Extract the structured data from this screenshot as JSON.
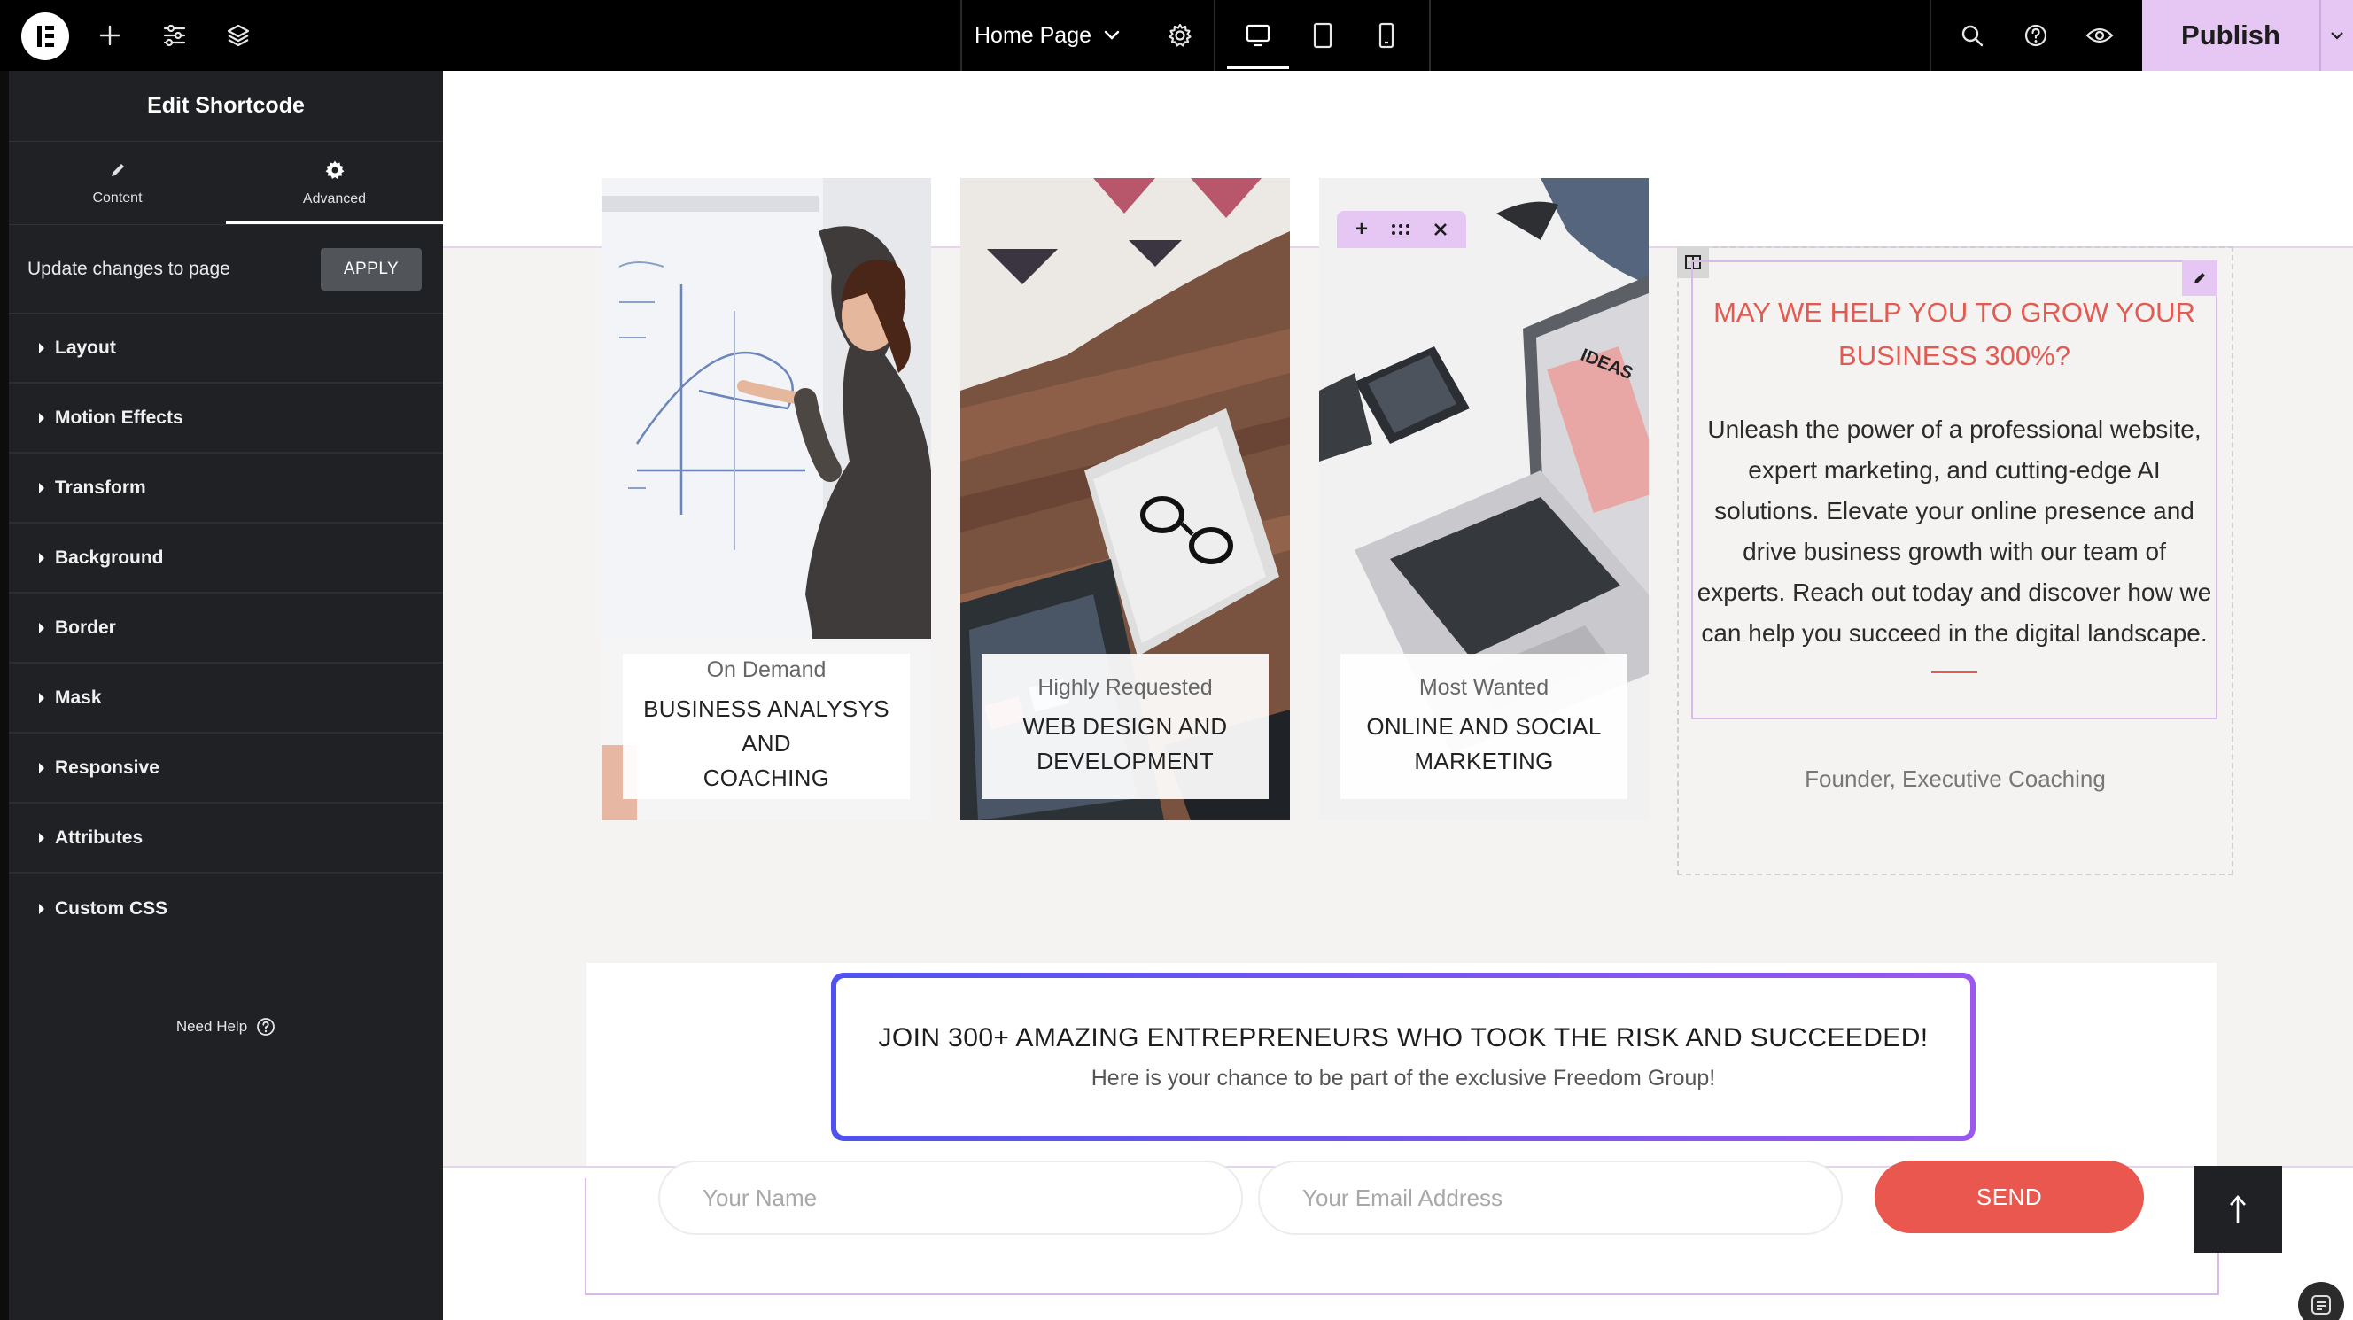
{
  "topbar": {
    "page_name": "Home Page",
    "publish_label": "Publish"
  },
  "panel": {
    "title": "Edit Shortcode",
    "tabs": [
      {
        "label": "Content"
      },
      {
        "label": "Advanced"
      }
    ],
    "update_label": "Update changes to page",
    "apply_label": "APPLY",
    "sections": [
      {
        "label": "Layout"
      },
      {
        "label": "Motion Effects"
      },
      {
        "label": "Transform"
      },
      {
        "label": "Background"
      },
      {
        "label": "Border"
      },
      {
        "label": "Mask"
      },
      {
        "label": "Responsive"
      },
      {
        "label": "Attributes"
      },
      {
        "label": "Custom CSS"
      }
    ],
    "need_help": "Need Help"
  },
  "cards": [
    {
      "subtitle": "On Demand",
      "title_line1": "BUSINESS ANALYSYS AND",
      "title_line2": "COACHING"
    },
    {
      "subtitle": "Highly Requested",
      "title_line1": "WEB DESIGN AND",
      "title_line2": "DEVELOPMENT"
    },
    {
      "subtitle": "Most Wanted",
      "title_line1": "ONLINE AND SOCIAL",
      "title_line2": "MARKETING"
    }
  ],
  "help": {
    "title_line1": "MAY WE HELP YOU TO GROW YOUR",
    "title_line2": "BUSINESS 300%?",
    "body_lines": [
      "Unleash the power of a professional website,",
      "expert marketing, and cutting-edge AI",
      "solutions. Elevate your online presence and",
      "drive business growth with our team of",
      "experts. Reach out today and discover how we",
      "can help you succeed in the digital landscape."
    ],
    "role": "Founder, Executive Coaching"
  },
  "cta": {
    "heading": "JOIN 300+ AMAZING ENTREPRENEURS WHO TOOK THE RISK AND SUCCEEDED!",
    "subheading": "Here is your chance to be part of the exclusive Freedom Group!"
  },
  "form": {
    "name_placeholder": "Your Name",
    "email_placeholder": "Your Email Address",
    "send_label": "SEND"
  },
  "colors": {
    "accent": "#e25b52",
    "publish_bg": "#e6c6f2",
    "panel_bg": "#1f2124",
    "cta_gradient_start": "#4f52f0",
    "cta_gradient_end": "#9b57f0"
  }
}
